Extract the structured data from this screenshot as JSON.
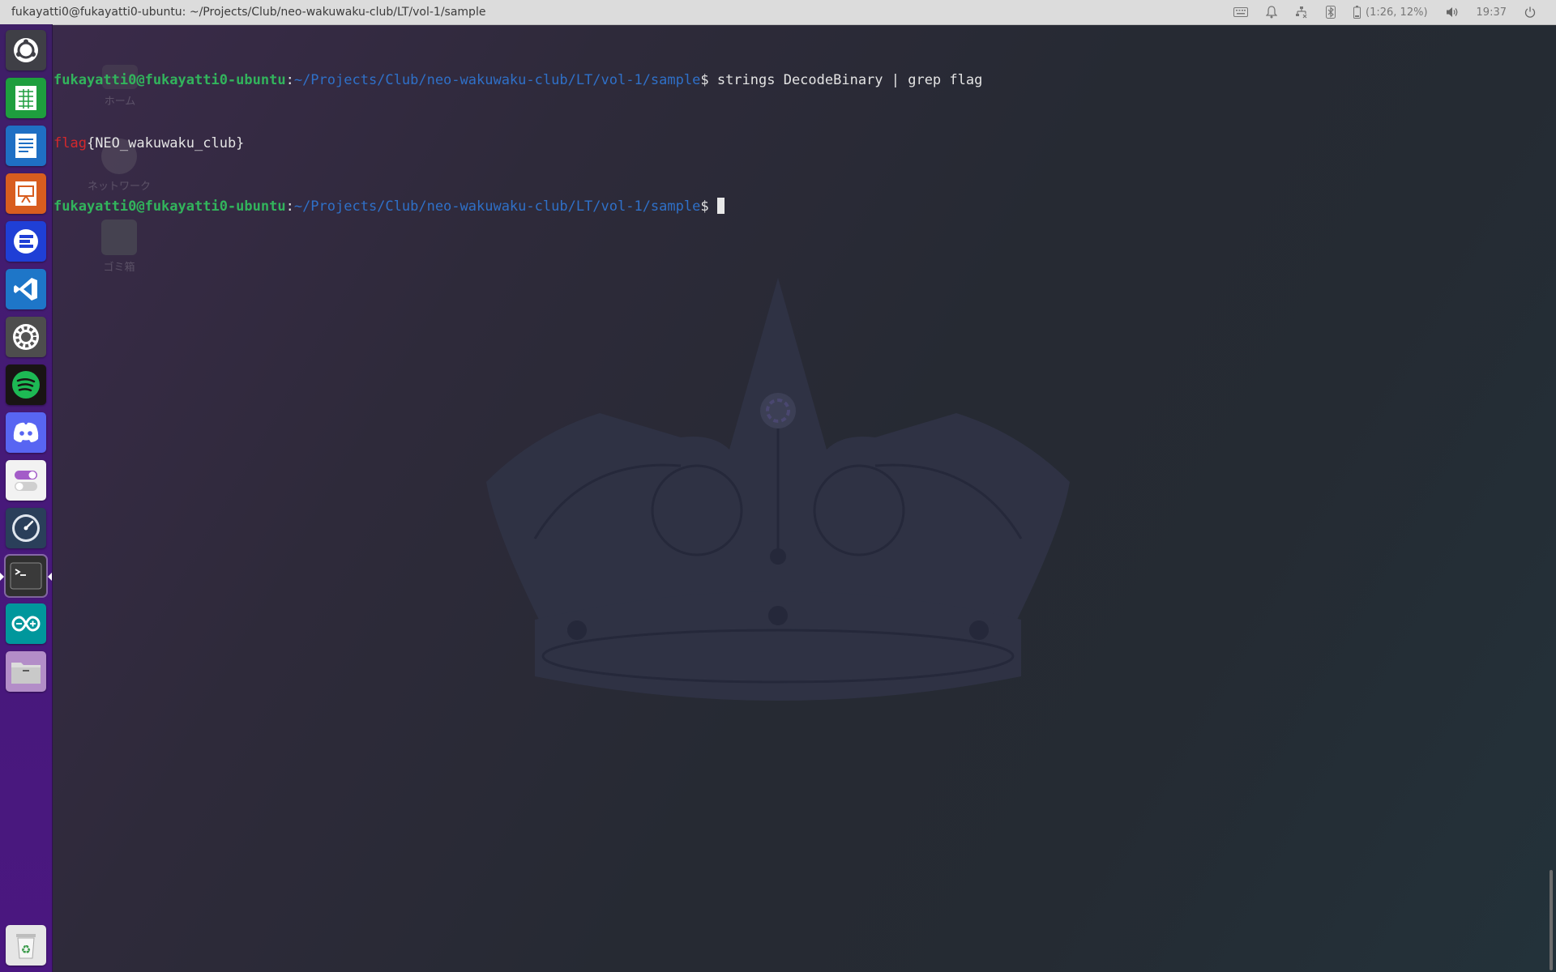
{
  "window": {
    "title": "fukayatti0@fukayatti0-ubuntu: ~/Projects/Club/neo-wakuwaku-club/LT/vol-1/sample"
  },
  "indicators": {
    "battery_text": "(1:26, 12%)",
    "clock": "19:37"
  },
  "launcher": {
    "items": [
      {
        "name": "ubuntu-dash",
        "color": "#3f3f46"
      },
      {
        "name": "libreoffice-calc",
        "color": "#1e9e3e"
      },
      {
        "name": "libreoffice-writer",
        "color": "#1f6fc4"
      },
      {
        "name": "libreoffice-impress",
        "color": "#d85d1f"
      },
      {
        "name": "app-e",
        "color": "#1f3fd6"
      },
      {
        "name": "visual-studio-code",
        "color": "#1e76c8"
      },
      {
        "name": "system-settings",
        "color": "#4d4d4d"
      },
      {
        "name": "spotify",
        "color": "#1db954"
      },
      {
        "name": "discord",
        "color": "#5865f2"
      },
      {
        "name": "unity-tweak",
        "color": "#f2f2f2"
      },
      {
        "name": "stacer",
        "color": "#2a3f5a"
      },
      {
        "name": "terminal",
        "color": "#3a3a3a"
      },
      {
        "name": "arduino",
        "color": "#00979c"
      },
      {
        "name": "files",
        "color": "#8e6aa7"
      },
      {
        "name": "trash",
        "color": "#e6e6e6"
      }
    ]
  },
  "desktop": {
    "home_label": "ホーム",
    "network_label": "ネットワーク",
    "trash_label": "ゴミ箱"
  },
  "terminal": {
    "user_host": "fukayatti0@fukayatti0-ubuntu",
    "colon": ":",
    "path": "~/Projects/Club/neo-wakuwaku-club/LT/vol-1/sample",
    "prompt_char": "$ ",
    "command": "strings DecodeBinary | grep flag",
    "output_keyword": "flag",
    "output_rest": "{NEO_wakuwaku_club}"
  }
}
